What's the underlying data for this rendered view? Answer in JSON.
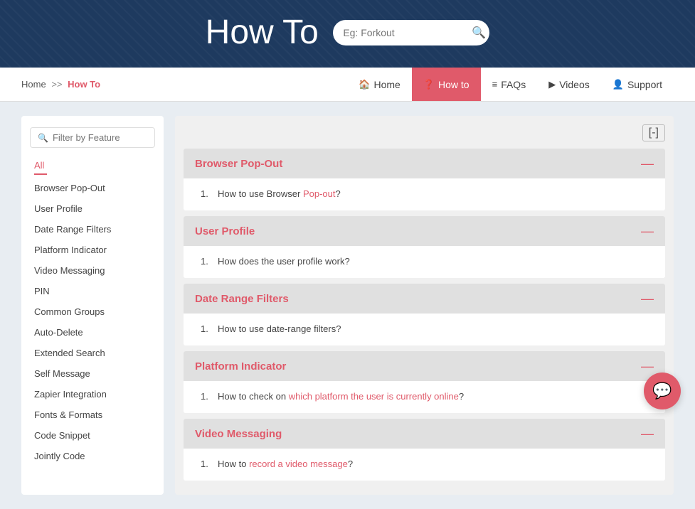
{
  "header": {
    "title": "How To",
    "search_placeholder": "Eg: Forkout"
  },
  "breadcrumb": {
    "home": "Home",
    "separator": ">>",
    "current": "How To"
  },
  "nav_tabs": [
    {
      "label": "Home",
      "icon": "🏠",
      "active": false
    },
    {
      "label": "How to",
      "icon": "❓",
      "active": true
    },
    {
      "label": "FAQs",
      "icon": "≡",
      "active": false
    },
    {
      "label": "Videos",
      "icon": "▶",
      "active": false
    },
    {
      "label": "Support",
      "icon": "👤",
      "active": false
    }
  ],
  "sidebar": {
    "search_placeholder": "Filter by Feature",
    "items": [
      {
        "label": "All",
        "active": true
      },
      {
        "label": "Browser Pop-Out",
        "active": false
      },
      {
        "label": "User Profile",
        "active": false
      },
      {
        "label": "Date Range Filters",
        "active": false
      },
      {
        "label": "Platform Indicator",
        "active": false
      },
      {
        "label": "Video Messaging",
        "active": false
      },
      {
        "label": "PIN",
        "active": false
      },
      {
        "label": "Common Groups",
        "active": false
      },
      {
        "label": "Auto-Delete",
        "active": false
      },
      {
        "label": "Extended Search",
        "active": false
      },
      {
        "label": "Self Message",
        "active": false
      },
      {
        "label": "Zapier Integration",
        "active": false
      },
      {
        "label": "Fonts & Formats",
        "active": false
      },
      {
        "label": "Code Snippet",
        "active": false
      },
      {
        "label": "Jointly Code",
        "active": false
      }
    ]
  },
  "collapse_btn": "[-]",
  "sections": [
    {
      "title": "Browser Pop-Out",
      "items": [
        {
          "num": "1.",
          "text_before": "How to use Browser ",
          "link": "Pop-out",
          "text_after": "?"
        }
      ]
    },
    {
      "title": "User Profile",
      "items": [
        {
          "num": "1.",
          "text_before": "How does the user profile work?",
          "link": "",
          "text_after": ""
        }
      ]
    },
    {
      "title": "Date Range Filters",
      "items": [
        {
          "num": "1.",
          "text_before": "How to use date-range filters?",
          "link": "",
          "text_after": ""
        }
      ]
    },
    {
      "title": "Platform Indicator",
      "items": [
        {
          "num": "1.",
          "text_before": "How to check on ",
          "link": "which platform the user is currently online",
          "text_after": "?"
        }
      ]
    },
    {
      "title": "Video Messaging",
      "items": [
        {
          "num": "1.",
          "text_before": "How to ",
          "link": "record a video message",
          "text_after": "?"
        }
      ]
    }
  ]
}
